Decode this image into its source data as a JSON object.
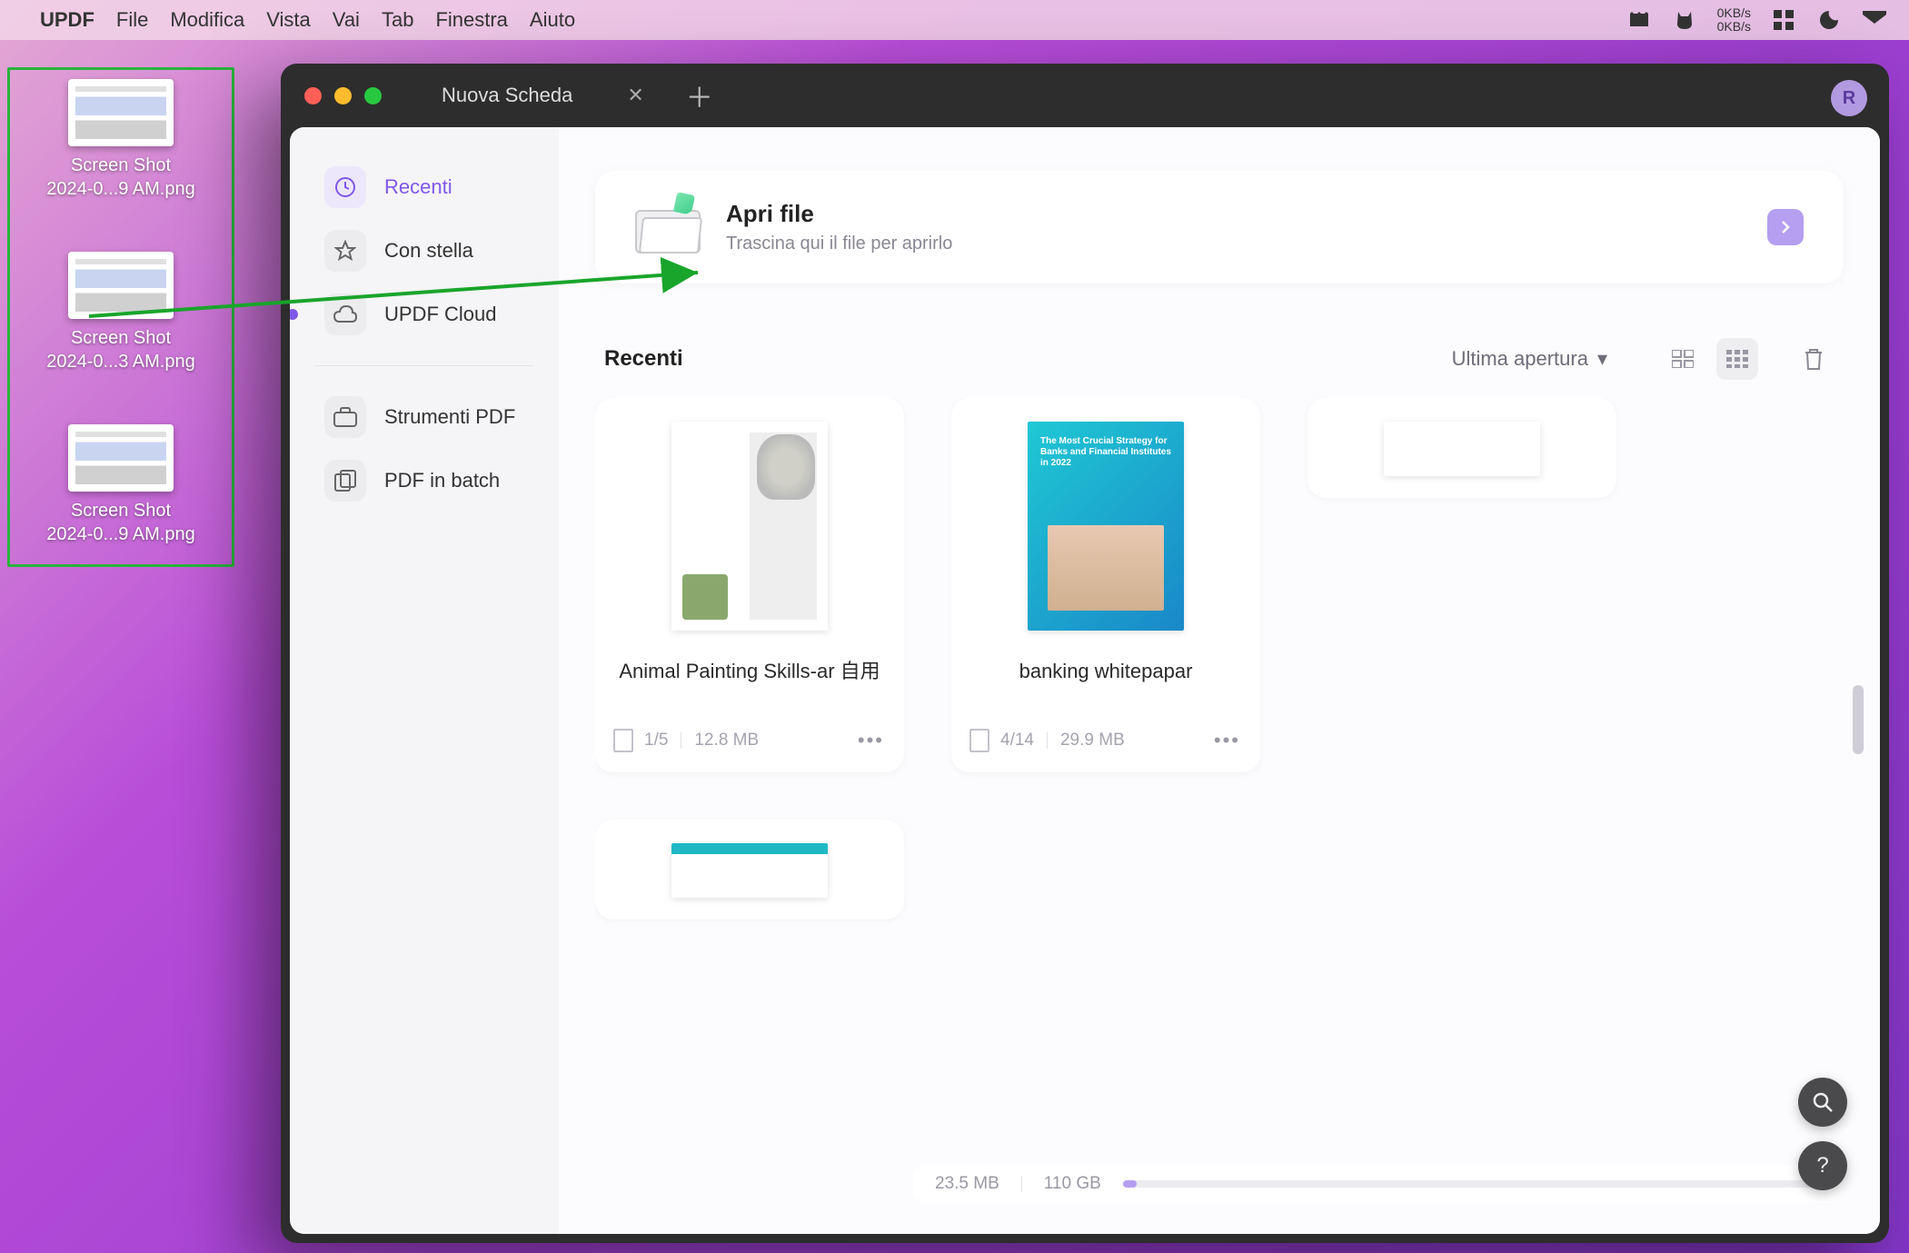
{
  "menubar": {
    "app": "UPDF",
    "items": [
      "File",
      "Modifica",
      "Vista",
      "Vai",
      "Tab",
      "Finestra",
      "Aiuto"
    ],
    "net_up": "0KB/s",
    "net_down": "0KB/s"
  },
  "desktop": {
    "items": [
      {
        "line1": "Screen Shot",
        "line2": "2024-0...9 AM.png"
      },
      {
        "line1": "Screen Shot",
        "line2": "2024-0...3 AM.png"
      },
      {
        "line1": "Screen Shot",
        "line2": "2024-0...9 AM.png"
      }
    ]
  },
  "window": {
    "tab_title": "Nuova Scheda",
    "avatar": "R"
  },
  "sidebar": {
    "recent": "Recenti",
    "starred": "Con stella",
    "cloud": "UPDF Cloud",
    "tools": "Strumenti PDF",
    "batch": "PDF in batch"
  },
  "open_card": {
    "title": "Apri file",
    "subtitle": "Trascina qui il file per aprirlo"
  },
  "list": {
    "title": "Recenti",
    "sort": "Ultima apertura"
  },
  "docs": [
    {
      "title": "Animal Painting Skills-ar 自用",
      "pages": "1/5",
      "size": "12.8 MB"
    },
    {
      "title": "banking whitepapar",
      "pages": "4/14",
      "size": "29.9 MB"
    }
  ],
  "bank_thumb_text": "The Most Crucial Strategy for Banks and Financial Institutes in 2022",
  "storage": {
    "used": "23.5 MB",
    "total": "110 GB"
  }
}
